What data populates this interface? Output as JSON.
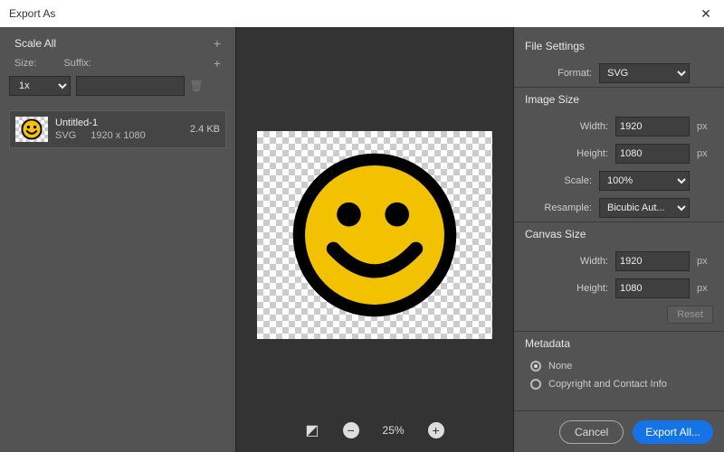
{
  "title": "Export As",
  "left": {
    "scale_all": "Scale All",
    "size_label": "Size:",
    "suffix_label": "Suffix:",
    "size_value": "1x",
    "suffix_value": "",
    "file": {
      "name": "Untitled-1",
      "format": "SVG",
      "dims": "1920 x 1080",
      "filesize": "2.4 KB"
    }
  },
  "zoom": {
    "level": "25%"
  },
  "right": {
    "file_settings": "File Settings",
    "format_label": "Format:",
    "format_value": "SVG",
    "image_size": "Image Size",
    "width_label": "Width:",
    "height_label": "Height:",
    "scale_label": "Scale:",
    "resample_label": "Resample:",
    "img_width": "1920",
    "img_height": "1080",
    "scale_value": "100%",
    "resample_value": "Bicubic Aut...",
    "canvas_size": "Canvas Size",
    "cv_width": "1920",
    "cv_height": "1080",
    "reset": "Reset",
    "metadata": "Metadata",
    "meta_none": "None",
    "meta_copyright": "Copyright and Contact Info",
    "px": "px"
  },
  "footer": {
    "cancel": "Cancel",
    "export": "Export All..."
  }
}
